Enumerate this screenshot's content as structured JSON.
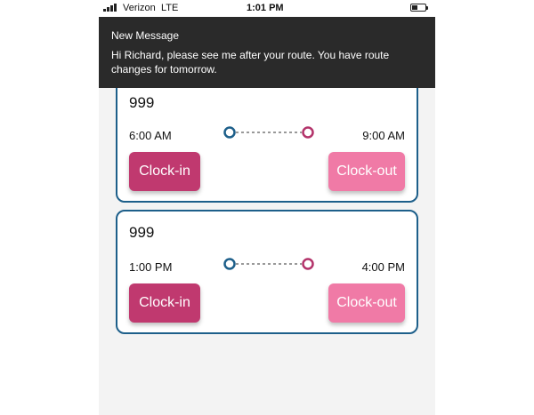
{
  "status_bar": {
    "carrier": "Verizon",
    "network": "LTE",
    "time": "1:01 PM"
  },
  "notification": {
    "title": "New Message",
    "body": "Hi Richard, please see me after your route.  You have route changes for tomorrow."
  },
  "routes": [
    {
      "number": "999",
      "start_time": "6:00 AM",
      "end_time": "9:00 AM",
      "clock_in_label": "Clock-in",
      "clock_out_label": "Clock-out"
    },
    {
      "number": "999",
      "start_time": "1:00 PM",
      "end_time": "4:00 PM",
      "clock_in_label": "Clock-in",
      "clock_out_label": "Clock-out"
    }
  ],
  "colors": {
    "card_border": "#1d5f8a",
    "clock_in": "#c0396f",
    "clock_out": "#f07aa6",
    "timeline_start": "#1d5f8a",
    "timeline_end": "#b3336a"
  },
  "icons": {
    "signal": "signal-bars-icon",
    "battery": "battery-icon",
    "timeline_start": "start-circle-icon",
    "timeline_end": "end-circle-icon"
  }
}
